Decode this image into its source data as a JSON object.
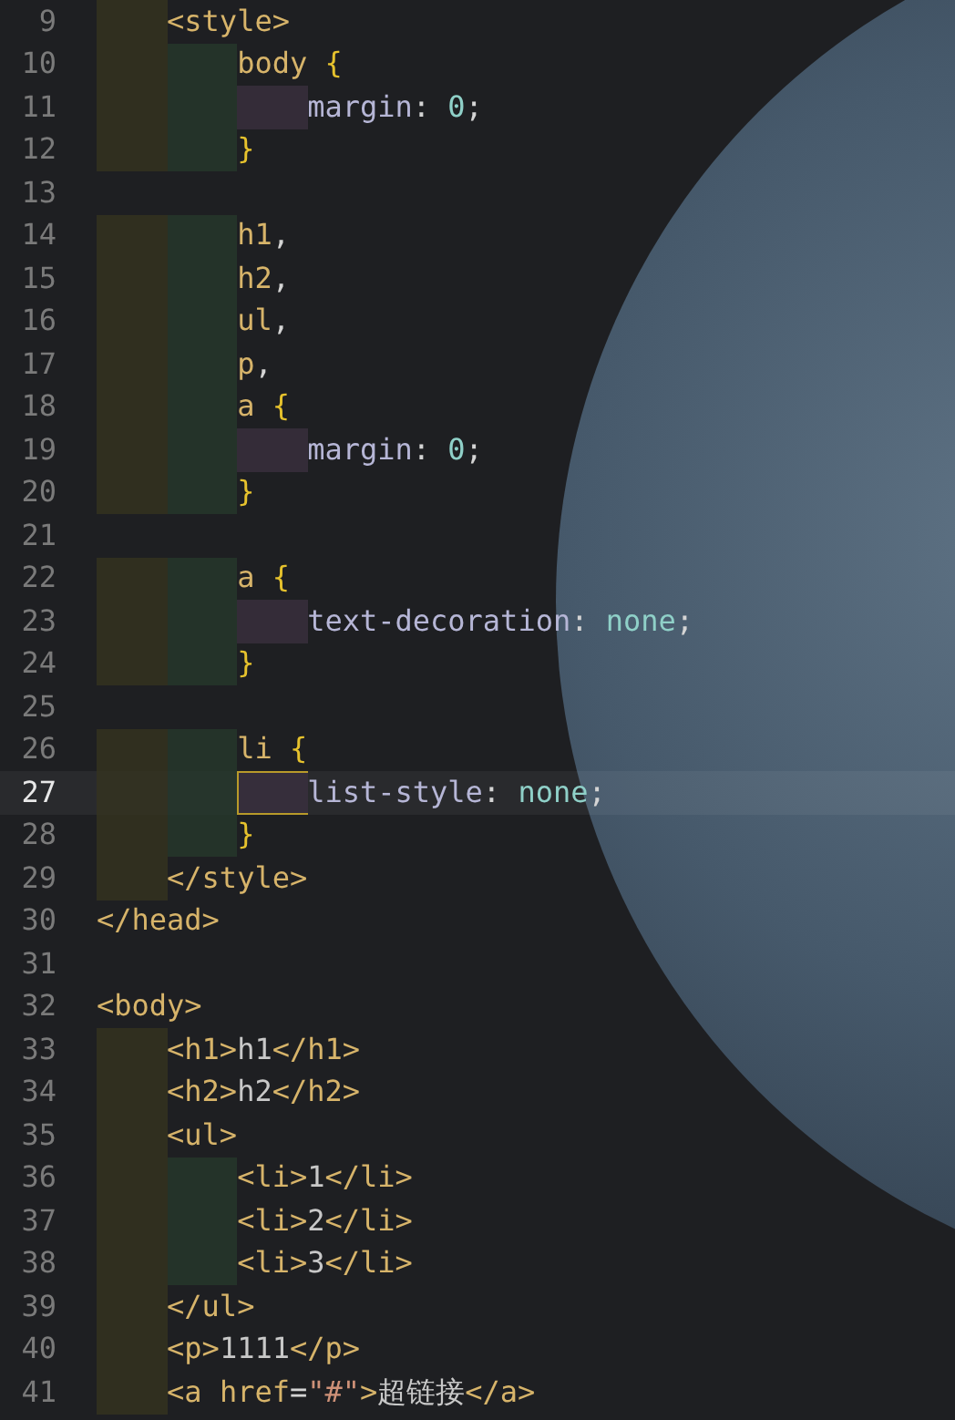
{
  "editor": {
    "lines": [
      {
        "number": "9",
        "current": false,
        "tokens": [
          {
            "kind": "tag",
            "text": "    <style>"
          }
        ]
      },
      {
        "number": "10",
        "current": false,
        "tokens": [
          {
            "kind": "selector",
            "text": "        body"
          },
          {
            "kind": "brace",
            "text": " {"
          }
        ]
      },
      {
        "number": "11",
        "current": false,
        "tokens": [
          {
            "kind": "property",
            "text": "            margin"
          },
          {
            "kind": "plain",
            "text": ": "
          },
          {
            "kind": "value",
            "text": "0"
          },
          {
            "kind": "plain",
            "text": ";"
          }
        ]
      },
      {
        "number": "12",
        "current": false,
        "tokens": [
          {
            "kind": "brace",
            "text": "        }"
          }
        ]
      },
      {
        "number": "13",
        "current": false
      },
      {
        "number": "14",
        "current": false,
        "tokens": [
          {
            "kind": "selector",
            "text": "        h1"
          },
          {
            "kind": "plain",
            "text": ","
          }
        ]
      },
      {
        "number": "15",
        "current": false,
        "tokens": [
          {
            "kind": "selector",
            "text": "        h2"
          },
          {
            "kind": "plain",
            "text": ","
          }
        ]
      },
      {
        "number": "16",
        "current": false,
        "tokens": [
          {
            "kind": "selector",
            "text": "        ul"
          },
          {
            "kind": "plain",
            "text": ","
          }
        ]
      },
      {
        "number": "17",
        "current": false,
        "tokens": [
          {
            "kind": "selector",
            "text": "        p"
          },
          {
            "kind": "plain",
            "text": ","
          }
        ]
      },
      {
        "number": "18",
        "current": false,
        "tokens": [
          {
            "kind": "selector",
            "text": "        a"
          },
          {
            "kind": "brace",
            "text": " {"
          }
        ]
      },
      {
        "number": "19",
        "current": false,
        "tokens": [
          {
            "kind": "property",
            "text": "            margin"
          },
          {
            "kind": "plain",
            "text": ": "
          },
          {
            "kind": "value",
            "text": "0"
          },
          {
            "kind": "plain",
            "text": ";"
          }
        ]
      },
      {
        "number": "20",
        "current": false,
        "tokens": [
          {
            "kind": "brace",
            "text": "        }"
          }
        ]
      },
      {
        "number": "21",
        "current": false
      },
      {
        "number": "22",
        "current": false,
        "tokens": [
          {
            "kind": "selector",
            "text": "        a"
          },
          {
            "kind": "brace",
            "text": " {"
          }
        ]
      },
      {
        "number": "23",
        "current": false,
        "tokens": [
          {
            "kind": "property",
            "text": "            text-decoration"
          },
          {
            "kind": "plain",
            "text": ": "
          },
          {
            "kind": "value",
            "text": "none"
          },
          {
            "kind": "plain",
            "text": ";"
          }
        ]
      },
      {
        "number": "24",
        "current": false,
        "tokens": [
          {
            "kind": "brace",
            "text": "        }"
          }
        ]
      },
      {
        "number": "25",
        "current": false
      },
      {
        "number": "26",
        "current": false,
        "tokens": [
          {
            "kind": "selector",
            "text": "        li"
          },
          {
            "kind": "brace",
            "text": " {"
          }
        ]
      },
      {
        "number": "27",
        "current": true,
        "tokens": [
          {
            "kind": "property",
            "text": "            list-style"
          },
          {
            "kind": "plain",
            "text": ": "
          },
          {
            "kind": "value",
            "text": "none"
          },
          {
            "kind": "plain",
            "text": ";"
          }
        ]
      },
      {
        "number": "28",
        "current": false,
        "tokens": [
          {
            "kind": "brace",
            "text": "        }"
          }
        ]
      },
      {
        "number": "29",
        "current": false,
        "tokens": [
          {
            "kind": "tag",
            "text": "    </style>"
          }
        ]
      },
      {
        "number": "30",
        "current": false,
        "tokens": [
          {
            "kind": "tag",
            "text": "</head>"
          }
        ]
      },
      {
        "number": "31",
        "current": false
      },
      {
        "number": "32",
        "current": false,
        "tokens": [
          {
            "kind": "tag",
            "text": "<body>"
          }
        ]
      },
      {
        "number": "33",
        "current": false,
        "tokens": [
          {
            "kind": "tag",
            "text": "    <h1>"
          },
          {
            "kind": "text",
            "text": "h1"
          },
          {
            "kind": "tag",
            "text": "</h1>"
          }
        ]
      },
      {
        "number": "34",
        "current": false,
        "tokens": [
          {
            "kind": "tag",
            "text": "    <h2>"
          },
          {
            "kind": "text",
            "text": "h2"
          },
          {
            "kind": "tag",
            "text": "</h2>"
          }
        ]
      },
      {
        "number": "35",
        "current": false,
        "tokens": [
          {
            "kind": "tag",
            "text": "    <ul>"
          }
        ]
      },
      {
        "number": "36",
        "current": false,
        "tokens": [
          {
            "kind": "tag",
            "text": "        <li>"
          },
          {
            "kind": "text",
            "text": "1"
          },
          {
            "kind": "tag",
            "text": "</li>"
          }
        ]
      },
      {
        "number": "37",
        "current": false,
        "tokens": [
          {
            "kind": "tag",
            "text": "        <li>"
          },
          {
            "kind": "text",
            "text": "2"
          },
          {
            "kind": "tag",
            "text": "</li>"
          }
        ]
      },
      {
        "number": "38",
        "current": false,
        "tokens": [
          {
            "kind": "tag",
            "text": "        <li>"
          },
          {
            "kind": "text",
            "text": "3"
          },
          {
            "kind": "tag",
            "text": "</li>"
          }
        ]
      },
      {
        "number": "39",
        "current": false,
        "tokens": [
          {
            "kind": "tag",
            "text": "    </ul>"
          }
        ]
      },
      {
        "number": "40",
        "current": false,
        "tokens": [
          {
            "kind": "tag",
            "text": "    <p>"
          },
          {
            "kind": "text",
            "text": "1111"
          },
          {
            "kind": "tag",
            "text": "</p>"
          }
        ]
      },
      {
        "number": "41",
        "current": false,
        "tokens": [
          {
            "kind": "tag",
            "text": "    <a "
          },
          {
            "kind": "attr",
            "text": "href"
          },
          {
            "kind": "plain",
            "text": "="
          },
          {
            "kind": "string",
            "text": "\"#\""
          },
          {
            "kind": "tag",
            "text": ">"
          },
          {
            "kind": "text",
            "text": "超链接"
          },
          {
            "kind": "tag",
            "text": "</a>"
          }
        ]
      }
    ]
  }
}
